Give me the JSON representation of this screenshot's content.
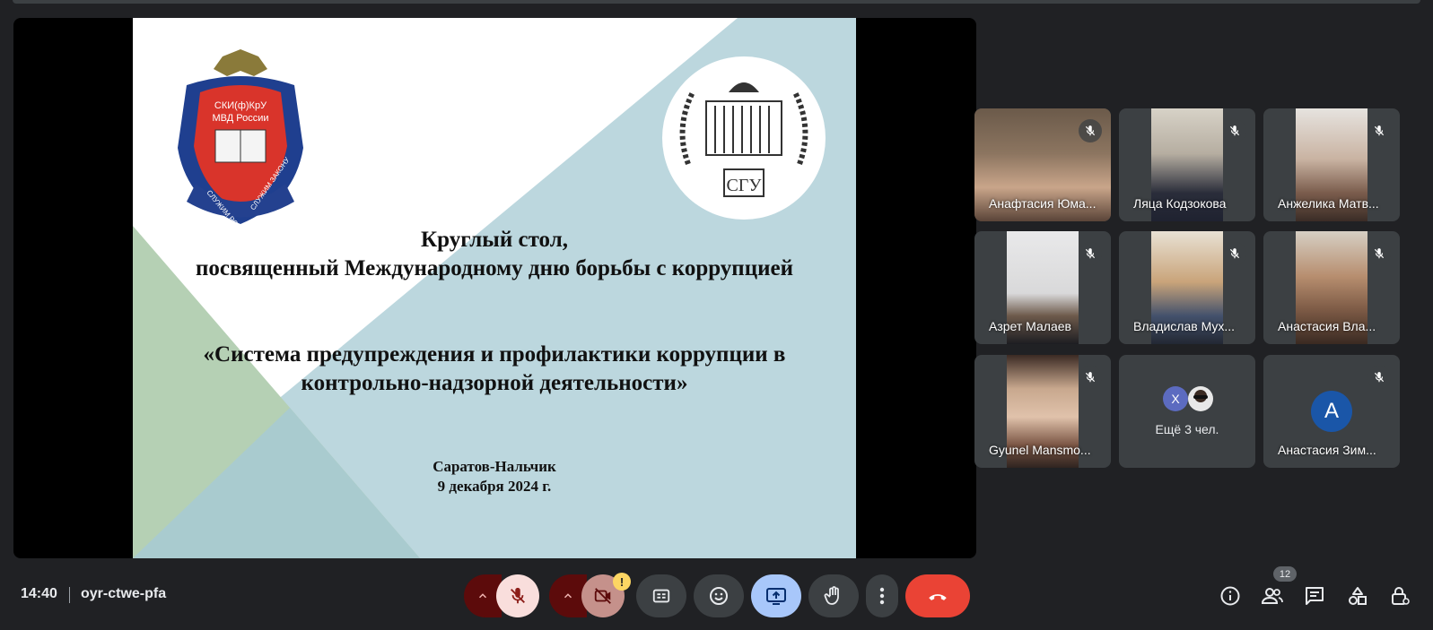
{
  "meeting": {
    "time": "14:40",
    "code": "oyr-ctwe-pfa"
  },
  "slide": {
    "crest_lines": [
      "СКИ(ф)КрУ",
      "МВД России"
    ],
    "crest_ribbon_left": "СЛУЖИМ РОССИИ",
    "crest_ribbon_right": "СЛУЖИМ ЗАКОНУ",
    "logo_text": "СГУ",
    "title_line1": "Круглый стол,",
    "title_line2": "посвященный Международному дню борьбы с коррупцией",
    "topic_line1": "«Система предупреждения и профилактики коррупции в",
    "topic_line2": "контрольно-надзорной деятельности»",
    "place": "Саратов-Нальчик",
    "date": "9 декабря 2024 г."
  },
  "participants": [
    {
      "name": "Анафтасия Юма...",
      "muted": true
    },
    {
      "name": "Ляца Кодзокова",
      "muted": true
    },
    {
      "name": "Анжелика Матв...",
      "muted": true
    },
    {
      "name": "Азрет Малаев",
      "muted": true
    },
    {
      "name": "Владислав Мух...",
      "muted": true
    },
    {
      "name": "Анастасия Вла...",
      "muted": true
    },
    {
      "name": "Gyunel Mansmo...",
      "muted": true
    },
    {
      "name": "Ещё 3 чел.",
      "avatar_letter": "Х"
    },
    {
      "name": "Анастасия Зим...",
      "avatar_letter": "А",
      "muted": true
    }
  ],
  "controls": {
    "warning_mark": "!",
    "people_count": "12"
  },
  "colors": {
    "end_call": "#ea4335",
    "mic_off_bg": "#f9dedc",
    "cam_off_bg": "#c5918b",
    "present_bg": "#a8c7fa",
    "slide_blue": "#bcd7de",
    "slide_green": "#b5d0b4"
  },
  "icons": [
    "mic-off-icon",
    "camera-off-icon",
    "captions-icon",
    "emoji-icon",
    "present-icon",
    "raise-hand-icon",
    "more-options-icon",
    "end-call-icon",
    "info-icon",
    "people-icon",
    "chat-icon",
    "activities-icon",
    "host-controls-icon"
  ]
}
